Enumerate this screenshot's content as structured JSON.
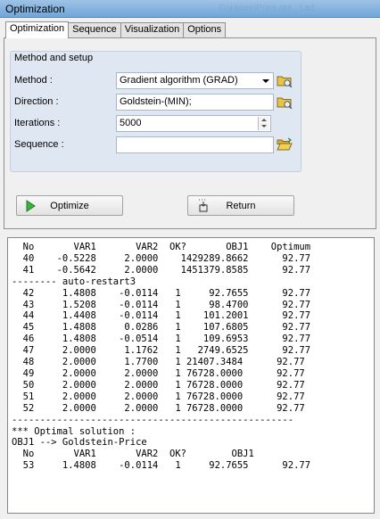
{
  "window": {
    "title": "Optimization",
    "background_title": "GoldsteinPrice.opt - Lad"
  },
  "tabs": [
    {
      "label": "Optimization",
      "active": true
    },
    {
      "label": "Sequence",
      "active": false
    },
    {
      "label": "Visualization",
      "active": false
    },
    {
      "label": "Options",
      "active": false
    }
  ],
  "setup": {
    "title": "Method and setup",
    "method_label": "Method :",
    "method_value": "Gradient algorithm (GRAD)",
    "direction_label": "Direction :",
    "direction_value": "Goldstein-(MIN);",
    "iterations_label": "Iterations :",
    "iterations_value": "5000",
    "sequence_label": "Sequence :",
    "sequence_value": ""
  },
  "buttons": {
    "optimize": "Optimize",
    "return": "Return"
  },
  "output": {
    "lines": [
      "  No       VAR1       VAR2  OK?       OBJ1    Optimum",
      "  40    -0.5228     2.0000    1429289.8662      92.77",
      "  41    -0.5642     2.0000    1451379.8585      92.77",
      "-------- auto-restart3",
      "  42     1.4808    -0.0114   1     92.7655      92.77",
      "  43     1.5208    -0.0114   1     98.4700      92.77",
      "  44     1.4408    -0.0114   1    101.2001      92.77",
      "  45     1.4808     0.0286   1    107.6805      92.77",
      "  46     1.4808    -0.0514   1    109.6953      92.77",
      "  47     2.0000     1.1762   1   2749.6525      92.77",
      "  48     2.0000     1.7700   1 21407.3484      92.77",
      "  49     2.0000     2.0000   1 76728.0000      92.77",
      "  50     2.0000     2.0000   1 76728.0000      92.77",
      "  51     2.0000     2.0000   1 76728.0000      92.77",
      "  52     2.0000     2.0000   1 76728.0000      92.77",
      "--------------------------------------------------",
      "*** Optimal solution :",
      "OBJ1 --> Goldstein-Price",
      "  No       VAR1       VAR2  OK?        OBJ1",
      "  53     1.4808    -0.0114   1     92.7655      92.77"
    ]
  },
  "colors": {
    "titlebar": "#6fa6d8",
    "group_bg": "#dfe8f2",
    "play_green": "#3cb043",
    "folder_yellow": "#e8c34a"
  },
  "icons": {
    "method_browse": "folder-icon",
    "direction_browse": "folder-icon",
    "sequence_browse": "open-folder-icon",
    "optimize": "play-icon",
    "return": "return-icon"
  }
}
